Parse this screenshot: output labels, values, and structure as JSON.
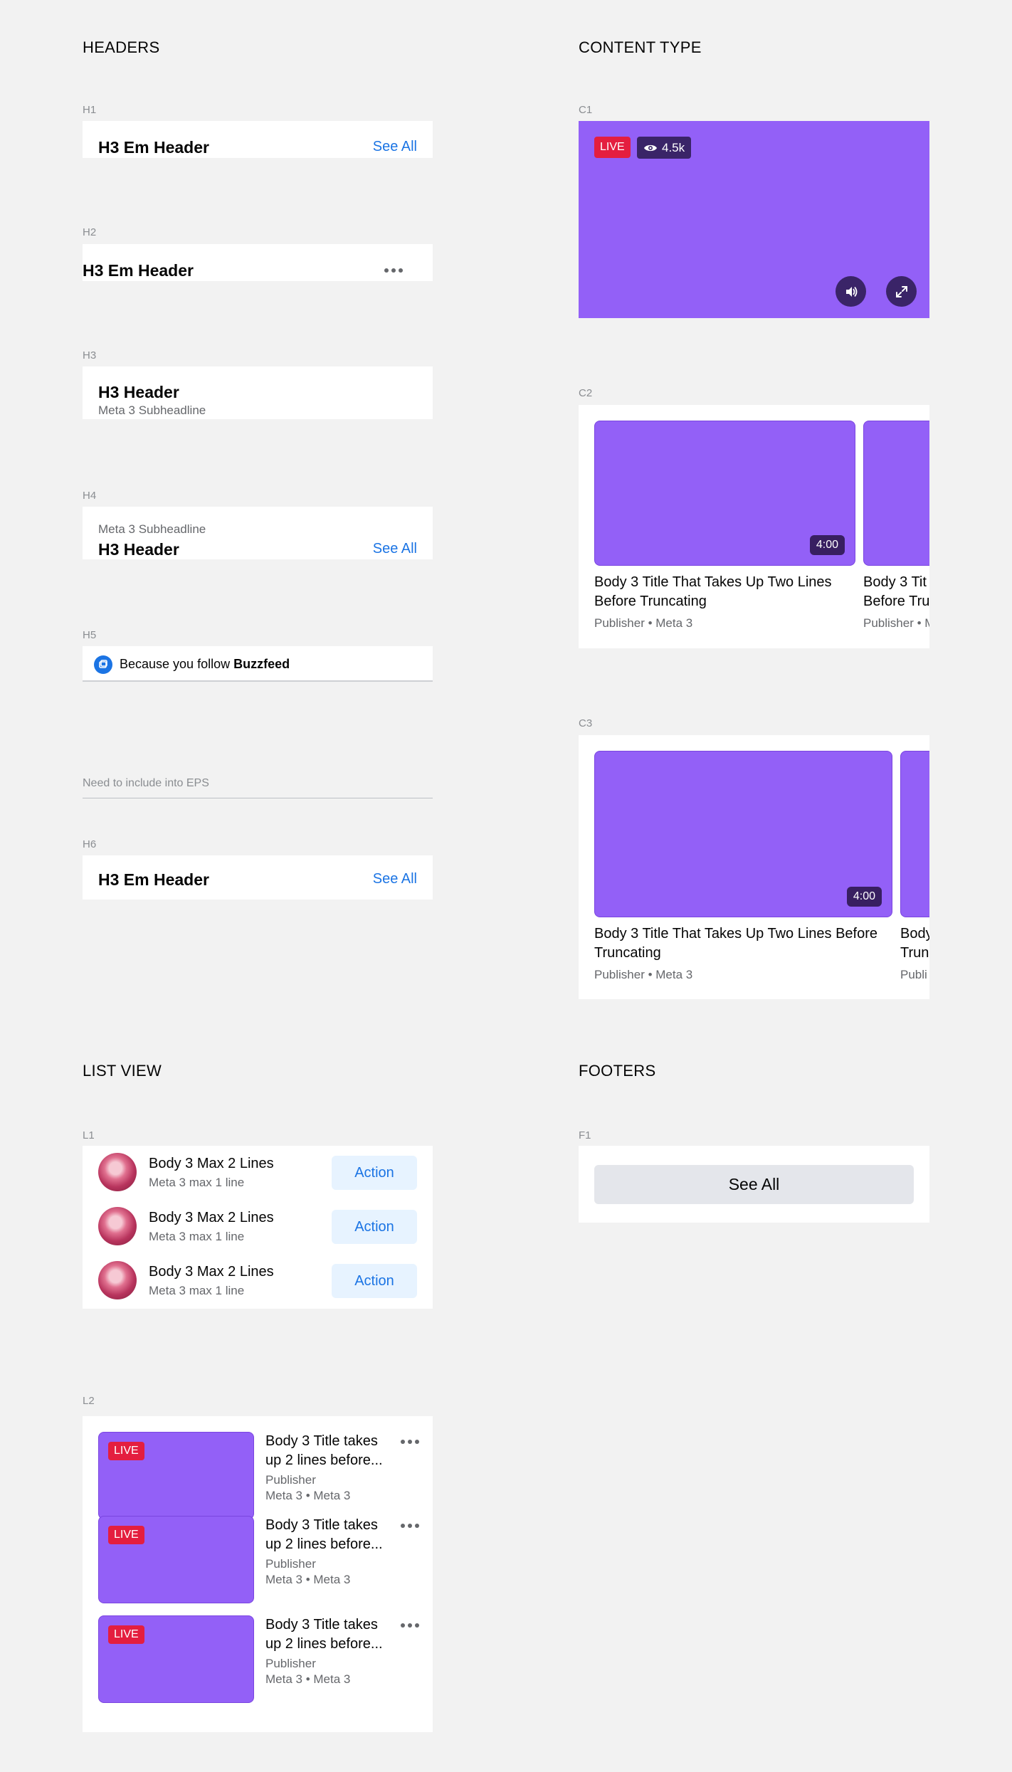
{
  "colors": {
    "accent": "#1b74e4",
    "purple": "#9360f7",
    "live": "#e41e3f",
    "background": "#f2f2f2"
  },
  "headers": {
    "title": "HEADERS",
    "h1": {
      "tag": "H1",
      "title": "H3 Em Header",
      "see_all": "See All"
    },
    "h2": {
      "tag": "H2",
      "title": "H3 Em Header",
      "more_icon": "more-horizontal-icon"
    },
    "h3": {
      "tag": "H3",
      "title": "H3 Header",
      "subtitle": "Meta 3 Subheadline"
    },
    "h4": {
      "tag": "H4",
      "subtitle": "Meta 3 Subheadline",
      "title": "H3 Header",
      "see_all": "See All"
    },
    "h5": {
      "tag": "H5",
      "text_prefix": "Because you follow ",
      "text_bold": "Buzzfeed",
      "icon": "page-icon"
    },
    "note": "Need to include into EPS",
    "h6": {
      "tag": "H6",
      "title": "H3 Em Header",
      "see_all": "See All"
    }
  },
  "content_type": {
    "title": "CONTENT TYPE",
    "c1": {
      "tag": "C1",
      "live": "LIVE",
      "views": "4.5k",
      "eye_icon": "eye-icon",
      "sound_icon": "speaker-icon",
      "fullscreen_icon": "expand-icon"
    },
    "c2": {
      "tag": "C2",
      "items": [
        {
          "duration": "4:00",
          "title_l1": "Body 3 Title That Takes Up Two Lines",
          "title_l2": "Before Truncating",
          "meta": "Publisher • Meta 3"
        },
        {
          "title_l1": "Body 3 Tit",
          "title_l2": "Before Tru",
          "meta": "Publisher • M"
        }
      ]
    },
    "c3": {
      "tag": "C3",
      "items": [
        {
          "duration": "4:00",
          "title_l1": "Body 3 Title That Takes Up Two Lines Before",
          "title_l2": "Truncating",
          "meta": "Publisher • Meta 3"
        },
        {
          "title_l1": "Body",
          "title_l2": "Trun",
          "meta": "Publi"
        }
      ]
    }
  },
  "list_view": {
    "title": "LIST VIEW",
    "l1": {
      "tag": "L1",
      "rows": [
        {
          "title": "Body 3 Max 2 Lines",
          "meta": "Meta 3 max 1 line",
          "action": "Action"
        },
        {
          "title": "Body 3 Max 2 Lines",
          "meta": "Meta 3 max 1 line",
          "action": "Action"
        },
        {
          "title": "Body 3 Max 2 Lines",
          "meta": "Meta 3 max 1 line",
          "action": "Action"
        }
      ]
    },
    "l2": {
      "tag": "L2",
      "rows": [
        {
          "live": "LIVE",
          "title_l1": "Body 3 Title takes",
          "title_l2": "up 2 lines before...",
          "publisher": "Publisher",
          "meta": "Meta 3 • Meta 3"
        },
        {
          "live": "LIVE",
          "title_l1": "Body 3 Title takes",
          "title_l2": "up 2 lines before...",
          "publisher": "Publisher",
          "meta": "Meta 3 • Meta 3"
        },
        {
          "live": "LIVE",
          "title_l1": "Body 3 Title takes",
          "title_l2": "up 2 lines before...",
          "publisher": "Publisher",
          "meta": "Meta 3 • Meta 3"
        }
      ]
    }
  },
  "footers": {
    "title": "FOOTERS",
    "f1": {
      "tag": "F1",
      "button": "See All"
    }
  }
}
